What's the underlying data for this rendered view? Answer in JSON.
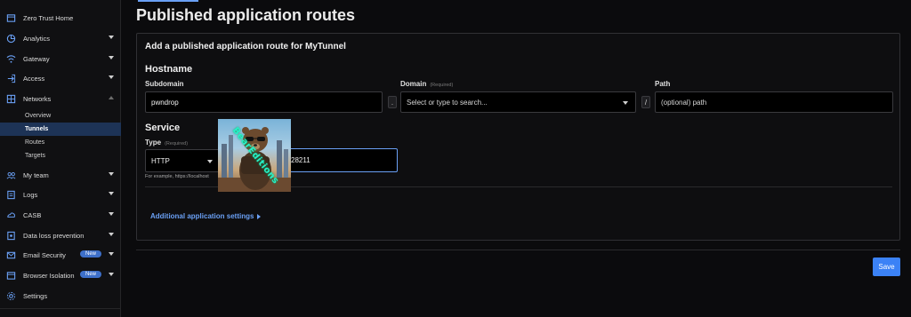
{
  "sidebar": {
    "items": [
      {
        "label": "Zero Trust Home",
        "icon": "home-icon"
      },
      {
        "label": "Analytics",
        "icon": "chart-icon"
      },
      {
        "label": "Gateway",
        "icon": "gateway-icon"
      },
      {
        "label": "Access",
        "icon": "access-icon"
      },
      {
        "label": "Networks",
        "icon": "networks-icon"
      },
      {
        "label": "My team",
        "icon": "team-icon"
      },
      {
        "label": "Logs",
        "icon": "logs-icon"
      },
      {
        "label": "CASB",
        "icon": "casb-icon"
      },
      {
        "label": "Data loss prevention",
        "icon": "dlp-icon"
      },
      {
        "label": "Email Security",
        "icon": "email-icon",
        "badge": "New"
      },
      {
        "label": "Browser Isolation",
        "icon": "browser-icon",
        "badge": "New"
      },
      {
        "label": "Settings",
        "icon": "gear-icon"
      }
    ],
    "networks_sub": [
      "Overview",
      "Tunnels",
      "Routes",
      "Targets"
    ]
  },
  "page": {
    "title": "Published application routes"
  },
  "form": {
    "card_title": "Add a published application route for MyTunnel",
    "hostname_heading": "Hostname",
    "subdomain_label": "Subdomain",
    "subdomain_value": "pwndrop",
    "domain_label": "Domain",
    "domain_required": "(Required)",
    "domain_placeholder": "Select or type to search...",
    "dot_sep": ".",
    "slash_sep": "/",
    "path_label": "Path",
    "path_placeholder": "(optional) path",
    "service_heading": "Service",
    "type_label": "Type",
    "type_required": "(Required)",
    "type_value": "HTTP",
    "url_value_visible": "28211",
    "hint_text": "For example, https://localhost",
    "additional_settings": "Additional application settings",
    "save_label": "Save"
  },
  "overlay": {
    "caption": "BearEditions"
  },
  "colors": {
    "accent": "#6aa0f5",
    "save_button": "#3b82f6",
    "active_nav": "#1d3356",
    "badge": "#3d6fc9"
  }
}
